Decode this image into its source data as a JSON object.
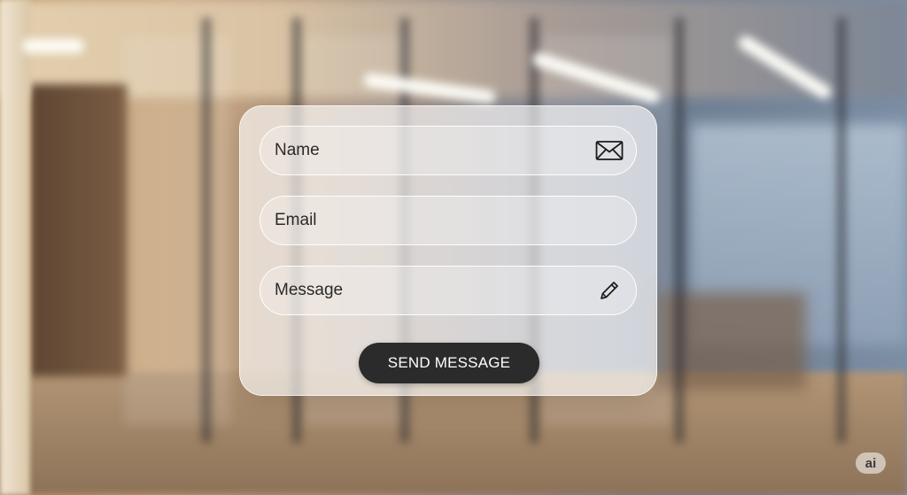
{
  "form": {
    "fields": [
      {
        "label": "Name",
        "icon": "envelope-icon"
      },
      {
        "label": "Email",
        "icon": ""
      },
      {
        "label": "Message",
        "icon": "pencil-icon"
      }
    ],
    "submit_label": "SEND MESSAGE"
  },
  "badge": {
    "text": "ai"
  },
  "colors": {
    "button_bg": "#2b2b2b",
    "button_text": "#ffffff",
    "field_text": "#2a2a2a"
  }
}
